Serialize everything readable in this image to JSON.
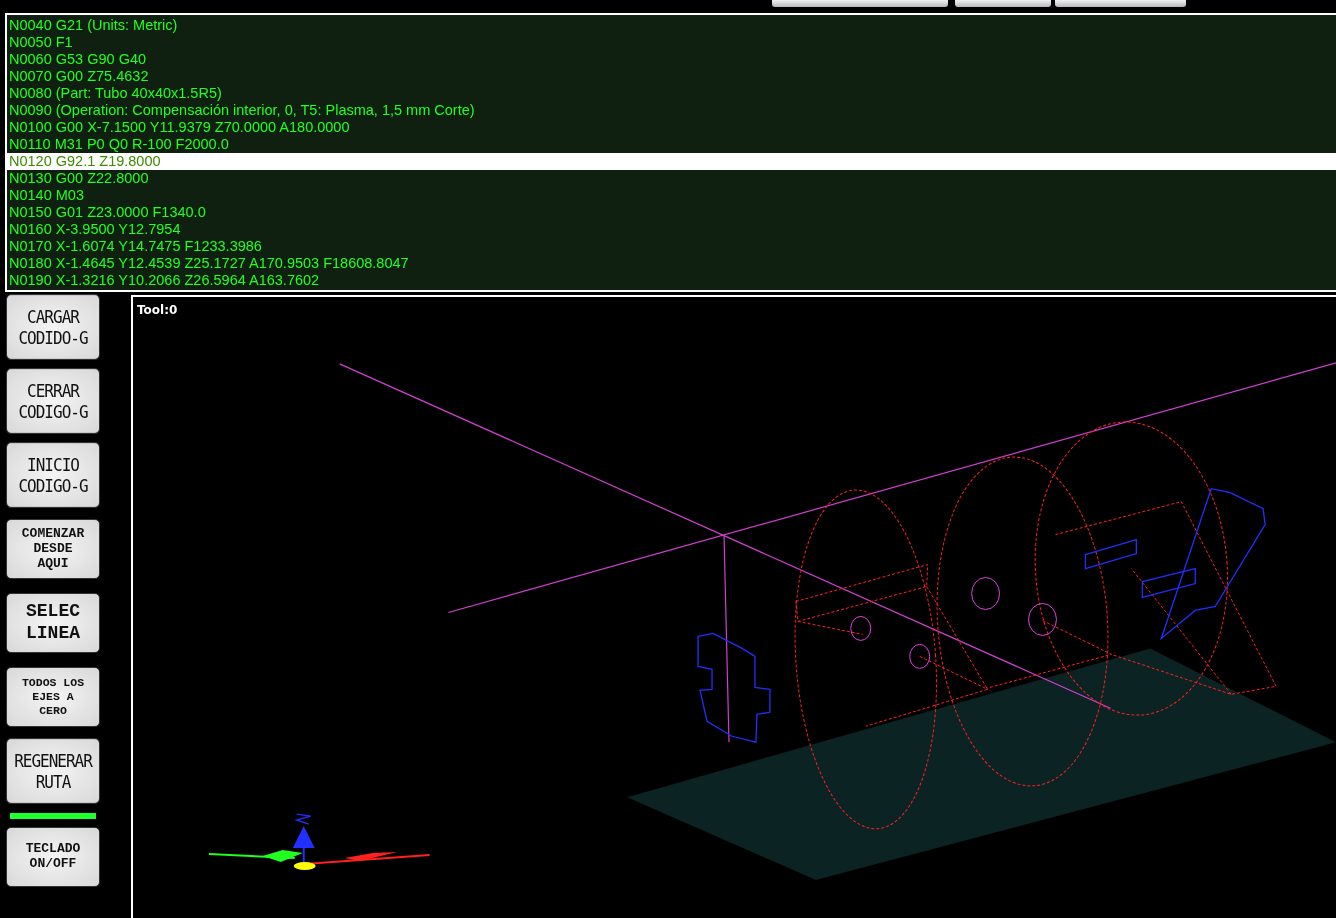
{
  "toolbar": {
    "buttons": [
      {
        "kind": "cut"
      },
      {
        "kind": "cut"
      },
      {
        "kind": "cut"
      }
    ]
  },
  "gcode": {
    "lines": [
      {
        "text": "N0040 G21 (Units: Metric)",
        "selected": false
      },
      {
        "text": "N0050 F1",
        "selected": false
      },
      {
        "text": "N0060 G53 G90 G40",
        "selected": false
      },
      {
        "text": "N0070 G00 Z75.4632",
        "selected": false
      },
      {
        "text": "N0080 (Part: Tubo 40x40x1.5R5)",
        "selected": false
      },
      {
        "text": "N0090 (Operation: Compensación interior, 0, T5: Plasma, 1,5 mm Corte)",
        "selected": false
      },
      {
        "text": "N0100 G00 X-7.1500 Y11.9379 Z70.0000 A180.0000",
        "selected": false
      },
      {
        "text": "N0110 M31 P0 Q0 R-100 F2000.0",
        "selected": false
      },
      {
        "text": "N0120 G92.1 Z19.8000",
        "selected": true
      },
      {
        "text": "N0130 G00 Z22.8000",
        "selected": false
      },
      {
        "text": "N0140 M03",
        "selected": false
      },
      {
        "text": "N0150 G01 Z23.0000 F1340.0",
        "selected": false
      },
      {
        "text": "N0160 X-3.9500 Y12.7954",
        "selected": false
      },
      {
        "text": "N0170 X-1.6074 Y14.7475 F1233.3986",
        "selected": false
      },
      {
        "text": "N0180 X-1.4645 Y12.4539 Z25.1727 A170.9503 F18608.8047",
        "selected": false
      },
      {
        "text": "N0190 X-1.3216 Y10.2066 Z26.5964 A163.7602",
        "selected": false
      }
    ]
  },
  "sidebar": {
    "buttons": [
      {
        "kind": "tall",
        "lines": [
          "CARGAR",
          "CODIDO-G"
        ]
      },
      {
        "kind": "tall",
        "lines": [
          "CERRAR",
          "CODIGO-G"
        ]
      },
      {
        "kind": "tall",
        "lines": [
          "INICIO",
          "CODIGO-G"
        ]
      },
      {
        "kind": "wide",
        "lines": [
          "COMENZAR",
          "DESDE",
          "AQUI"
        ]
      },
      {
        "kind": "big",
        "lines": [
          "SELEC",
          "LINEA"
        ]
      },
      {
        "kind": "small",
        "lines": [
          "TODOS LOS",
          "EJES A",
          "CERO"
        ]
      },
      {
        "kind": "tall",
        "lines": [
          "REGENERAR",
          "RUTA"
        ]
      }
    ],
    "indicator": {
      "on": true
    },
    "bottom_button": {
      "kind": "wide",
      "lines": [
        "TECLADO",
        "ON/OFF"
      ]
    }
  },
  "viewport": {
    "tool_label": "Tool:0"
  }
}
